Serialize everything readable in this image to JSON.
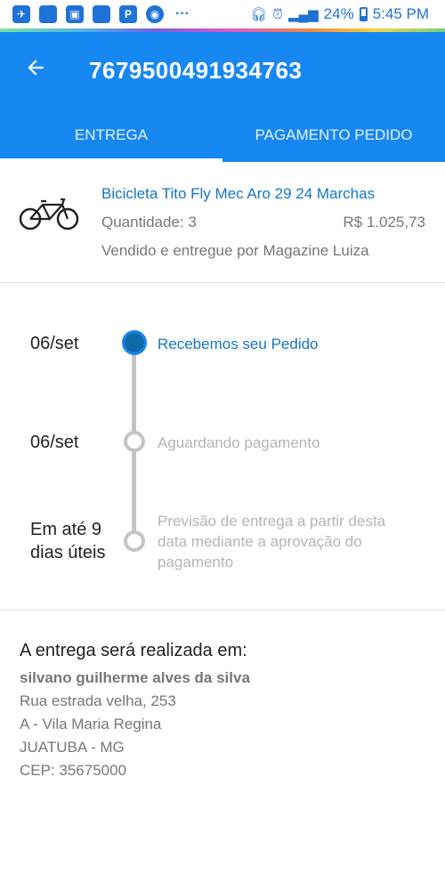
{
  "status_bar": {
    "battery": "24%",
    "time": "5:45 PM"
  },
  "header": {
    "order_number": "7679500491934763",
    "tabs": [
      {
        "label": "ENTREGA",
        "active": true
      },
      {
        "label": "PAGAMENTO PEDIDO",
        "active": false
      }
    ]
  },
  "product": {
    "name": "Bicicleta Tito Fly Mec Aro 29 24 Marchas",
    "quantity": "Quantidade: 3",
    "price": "R$ 1.025,73",
    "seller": "Vendido e entregue por Magazine Luiza"
  },
  "timeline": [
    {
      "date": "06/set",
      "text": "Recebemos seu Pedido",
      "done": true
    },
    {
      "date": "06/set",
      "text": "Aguardando pagamento",
      "done": false
    },
    {
      "date_lines": [
        "Em até 9",
        "dias úteis"
      ],
      "text_lines": [
        "Previsão de entrega a partir desta",
        "data mediante a aprovação do",
        "pagamento"
      ],
      "done": false
    }
  ],
  "delivery": {
    "heading": "A entrega será realizada em:",
    "recipient": "silvano guilherme alves da silva",
    "street": "Rua estrada velha, 253",
    "district": "A - Vila Maria Regina",
    "city": "JUATUBA - MG",
    "cep": "CEP: 35675000"
  },
  "colors": {
    "primary": "#1787f2",
    "link": "#1476c6",
    "muted": "#b4b4b4"
  }
}
